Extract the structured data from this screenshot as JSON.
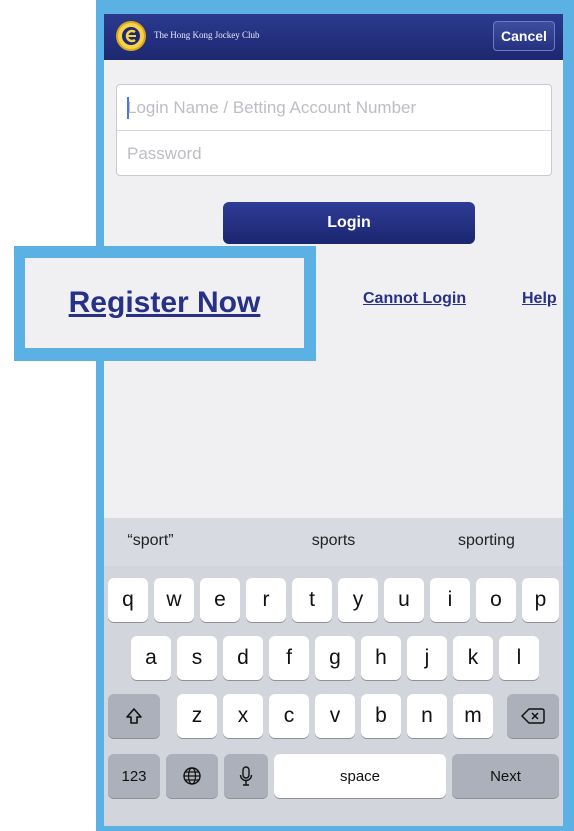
{
  "header": {
    "org_name": "The Hong Kong Jockey Club",
    "cancel_label": "Cancel",
    "logo_icon": "jockey-club-logo-icon"
  },
  "form": {
    "login_placeholder": "Login Name / Betting Account Number",
    "login_value": "",
    "password_placeholder": "Password",
    "password_value": ""
  },
  "actions": {
    "login_label": "Login",
    "register_label": "Register Now",
    "cannot_login_label": "Cannot Login",
    "help_label": "Help"
  },
  "keyboard": {
    "suggestions": [
      "“sport”",
      "sports",
      "sporting"
    ],
    "row1": [
      "q",
      "w",
      "e",
      "r",
      "t",
      "y",
      "u",
      "i",
      "o",
      "p"
    ],
    "row2": [
      "a",
      "s",
      "d",
      "f",
      "g",
      "h",
      "j",
      "k",
      "l"
    ],
    "row3": [
      "z",
      "x",
      "c",
      "v",
      "b",
      "n",
      "m"
    ],
    "shift_icon": "shift-icon",
    "delete_icon": "backspace-icon",
    "numbers_label": "123",
    "globe_icon": "globe-icon",
    "mic_icon": "microphone-icon",
    "space_label": "space",
    "next_label": "Next"
  },
  "colors": {
    "header": "#1e2870",
    "accent": "#263187",
    "frame": "#5bb0e4",
    "logo_gold": "#f6d24a"
  }
}
